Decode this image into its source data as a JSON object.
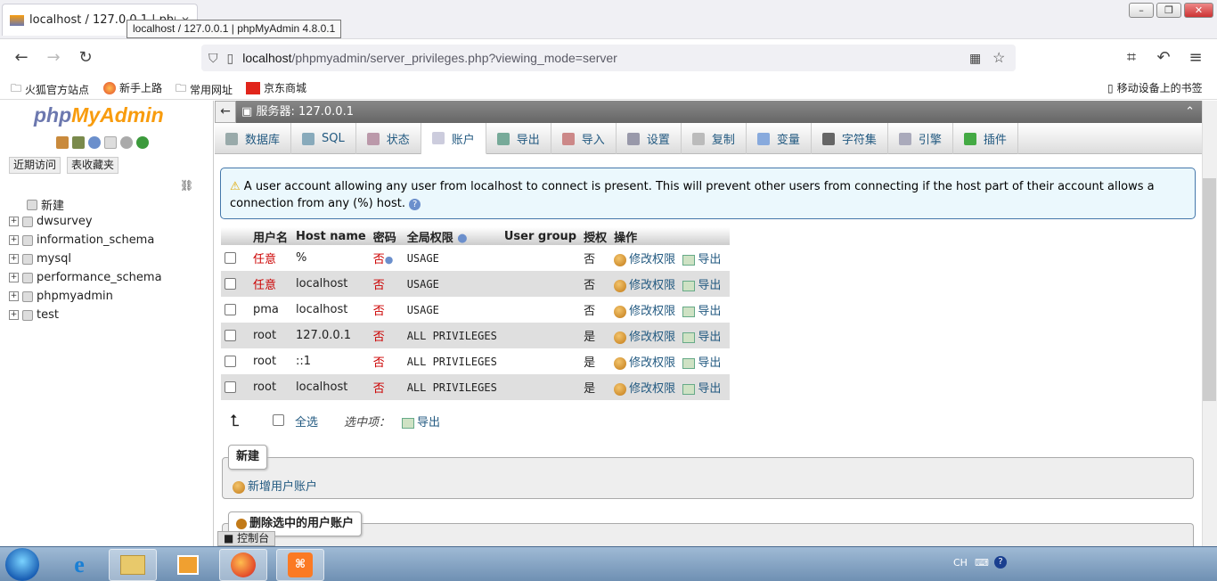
{
  "browser": {
    "tab_title": "localhost / 127.0.0.1 | phpMyAdmin 4.8.0.1",
    "tooltip": "localhost / 127.0.0.1 | phpMyAdmin 4.8.0.1",
    "url_host": "localhost",
    "url_path": "/phpmyadmin/server_privileges.php?viewing_mode=server",
    "window_controls": {
      "minimize": "–",
      "restore": "❐",
      "close": "✕"
    },
    "bookmarks": [
      "火狐官方站点",
      "新手上路",
      "常用网址",
      "京东商城"
    ],
    "mobile_bookmarks": "移动设备上的书签"
  },
  "leftnav": {
    "logo_php": "php",
    "logo_myadmin": "MyAdmin",
    "tabs": [
      "近期访问",
      "表收藏夹"
    ],
    "new_label": "新建",
    "databases": [
      "dwsurvey",
      "information_schema",
      "mysql",
      "performance_schema",
      "phpmyadmin",
      "test"
    ]
  },
  "server": {
    "breadcrumb": "服务器: 127.0.0.1",
    "menu": [
      "数据库",
      "SQL",
      "状态",
      "账户",
      "导出",
      "导入",
      "设置",
      "复制",
      "变量",
      "字符集",
      "引擎",
      "插件"
    ],
    "active_tab": "账户"
  },
  "notice": "A user account allowing any user from localhost to connect is present. This will prevent other users from connecting if the host part of their account allows a connection from any (%) host.",
  "users_table": {
    "headers": [
      "",
      "用户名",
      "Host name",
      "密码",
      "全局权限",
      "User group",
      "授权",
      "操作"
    ],
    "rows": [
      {
        "user": "任意",
        "host": "%",
        "password": "否",
        "privileges": "USAGE",
        "grant": "否"
      },
      {
        "user": "任意",
        "host": "localhost",
        "password": "否",
        "privileges": "USAGE",
        "grant": "否"
      },
      {
        "user": "pma",
        "host": "localhost",
        "password": "否",
        "privileges": "USAGE",
        "grant": "否"
      },
      {
        "user": "root",
        "host": "127.0.0.1",
        "password": "否",
        "privileges": "ALL PRIVILEGES",
        "grant": "是"
      },
      {
        "user": "root",
        "host": "::1",
        "password": "否",
        "privileges": "ALL PRIVILEGES",
        "grant": "是"
      },
      {
        "user": "root",
        "host": "localhost",
        "password": "否",
        "privileges": "ALL PRIVILEGES",
        "grant": "是"
      }
    ],
    "edit_label": "修改权限",
    "export_label": "导出"
  },
  "bulk": {
    "select_all": "全选",
    "with_selected": "选中项：",
    "export": "导出"
  },
  "new_user": {
    "legend": "新建",
    "add_link": "新增用户账户"
  },
  "delete_section": {
    "legend": "删除选中的用户账户"
  },
  "console_label": "控制台",
  "taskbar": {
    "lang": "CH"
  }
}
